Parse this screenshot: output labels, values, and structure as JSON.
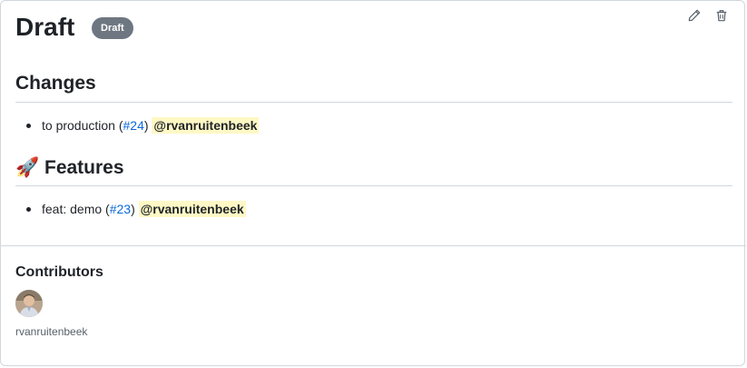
{
  "release": {
    "title": "Draft",
    "badge": "Draft"
  },
  "sections": [
    {
      "heading": "Changes",
      "emoji": "",
      "items": [
        {
          "text": "to production (",
          "link": "#24",
          "close": ")",
          "mention": "@rvanruitenbeek"
        }
      ]
    },
    {
      "heading": "Features",
      "emoji": "🚀",
      "items": [
        {
          "text": "feat: demo (",
          "link": "#23",
          "close": ")",
          "mention": "@rvanruitenbeek"
        }
      ]
    }
  ],
  "contributors": {
    "title": "Contributors",
    "names": [
      "rvanruitenbeek"
    ]
  },
  "icons": {
    "edit": "pencil-icon",
    "delete": "trash-icon"
  },
  "colors": {
    "badge": "#6e7781",
    "link": "#0969da",
    "mention_bg": "#fff8c5"
  }
}
